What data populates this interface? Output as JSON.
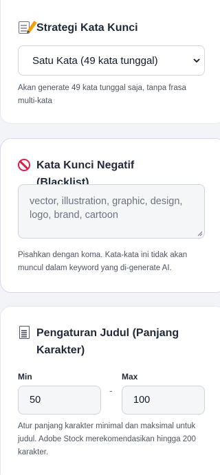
{
  "keyword_strategy": {
    "title": "Strategi Kata Kunci",
    "icon": "memo-icon",
    "selected_option": "Satu Kata (49 kata tunggal)",
    "help_text": "Akan generate 49 kata tunggal saja, tanpa frasa multi-kata"
  },
  "negative_keywords": {
    "title": "Kata Kunci Negatif (Blacklist)",
    "icon": "prohibited-icon",
    "placeholder": "vector, illustration, graphic, design, logo, brand, cartoon",
    "help_text": "Pisahkan dengan koma. Kata-kata ini tidak akan muncul dalam keyword yang di-generate AI."
  },
  "title_settings": {
    "title": "Pengaturan Judul (Panjang Karakter)",
    "icon": "page-icon",
    "min_label": "Min",
    "min_value": "50",
    "separator": "-",
    "max_label": "Max",
    "max_value": "100",
    "help_text": "Atur panjang karakter minimal dan maksimal untuk judul. Adobe Stock merekomendasikan hingga 200 karakter."
  },
  "colors": {
    "card_border": "#e8e9ef",
    "focused_card_border": "#d9d6fb",
    "input_bg": "#f5f6f8",
    "danger_icon": "#e11d48"
  }
}
